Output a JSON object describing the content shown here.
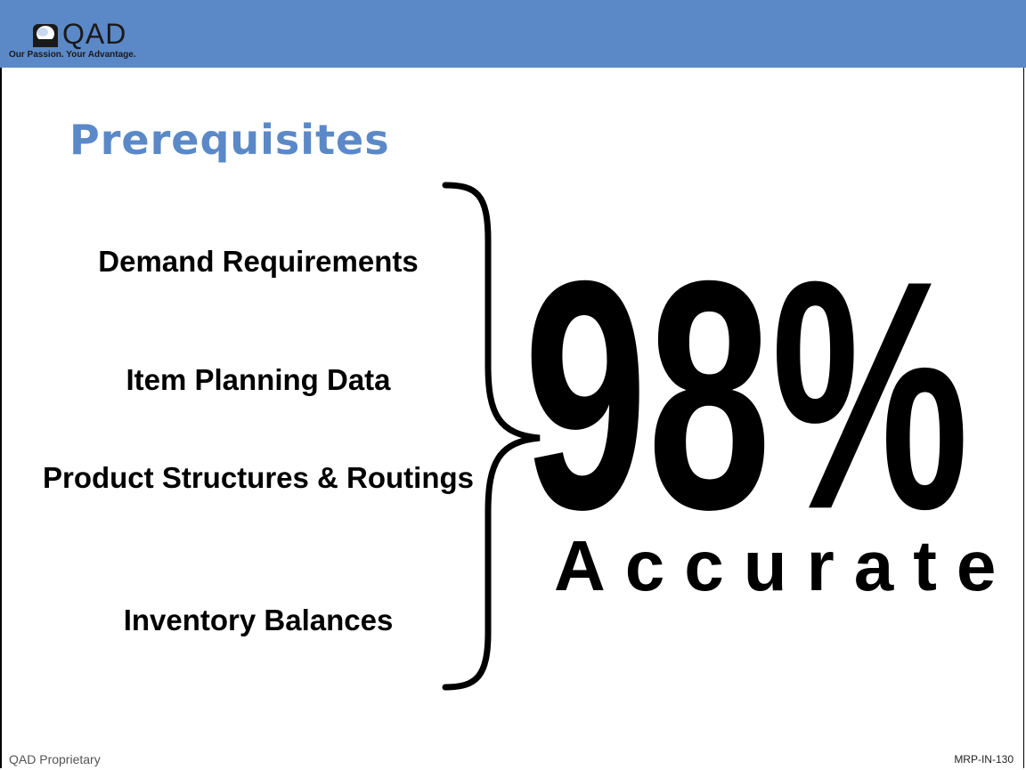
{
  "header": {
    "brand": "QAD",
    "tagline": "Our Passion. Your Advantage.",
    "bar_color": "#5b89c8"
  },
  "slide": {
    "title": "Prerequisites",
    "items": [
      "Demand Requirements",
      "Item Planning Data",
      "Product Structures & Routings",
      "Inventory Balances"
    ],
    "big_value": "98%",
    "big_label": "Accurate"
  },
  "footer": {
    "left": "QAD Proprietary",
    "right": "MRP-IN-130"
  },
  "icons": [
    "qad-logo-icon",
    "curly-brace-icon"
  ]
}
